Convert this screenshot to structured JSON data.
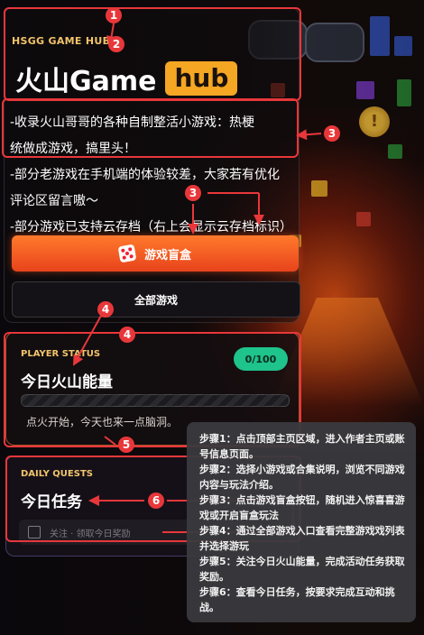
{
  "hero": {
    "eyebrow": "HSGG GAME HUB",
    "title_main": "火山Game",
    "title_badge": "hub",
    "desc_lines": [
      "-收录火山哥哥的各种自制整活小游戏：热梗",
      "统做成游戏，搞里头！",
      "-部分老游戏在手机端的体验较差，大家若有优化",
      "评论区留言嗷～",
      "-部分游戏已支持云存档（右上会显示云存档标识）"
    ],
    "primary_button": "游戏盲盒",
    "secondary_button": "全部游戏"
  },
  "player_status": {
    "label": "PLAYER STATUS",
    "heading": "今日火山能量",
    "count": "0/100",
    "progress": 0.0,
    "note": "点火开始，今天也来一点脑洞。"
  },
  "daily_quests": {
    "label": "DAILY QUESTS",
    "heading": "今日任务",
    "row_text": "关注 · 领取今日奖励"
  },
  "tooltip": {
    "steps": [
      "步骤1：点击顶部主页区域，进入作者主页或账号信息页面。",
      "步骤2：选择小游戏或合集说明，浏览不同游戏内容与玩法介绍。",
      "步骤3：点击游戏盲盒按钮，随机进入惊喜喜游戏或开启盲盒玩法",
      "步骤4：通过全部游戏入口查看完整游戏戏列表并选择游玩",
      "步骤5：关注今日火山能量，完成活动任务获取奖励。",
      "步骤6：查看今日任务，按要求完成互动和挑战。"
    ]
  },
  "annotations": [
    "1",
    "2",
    "3",
    "3",
    "4",
    "4",
    "5",
    "6"
  ],
  "colors": {
    "accent": "#f5a623",
    "primary": "#ff7a2c",
    "annotation": "#e8373a",
    "energy": "#1fc38c"
  },
  "icons": {
    "primary_button": "dice-icon"
  }
}
